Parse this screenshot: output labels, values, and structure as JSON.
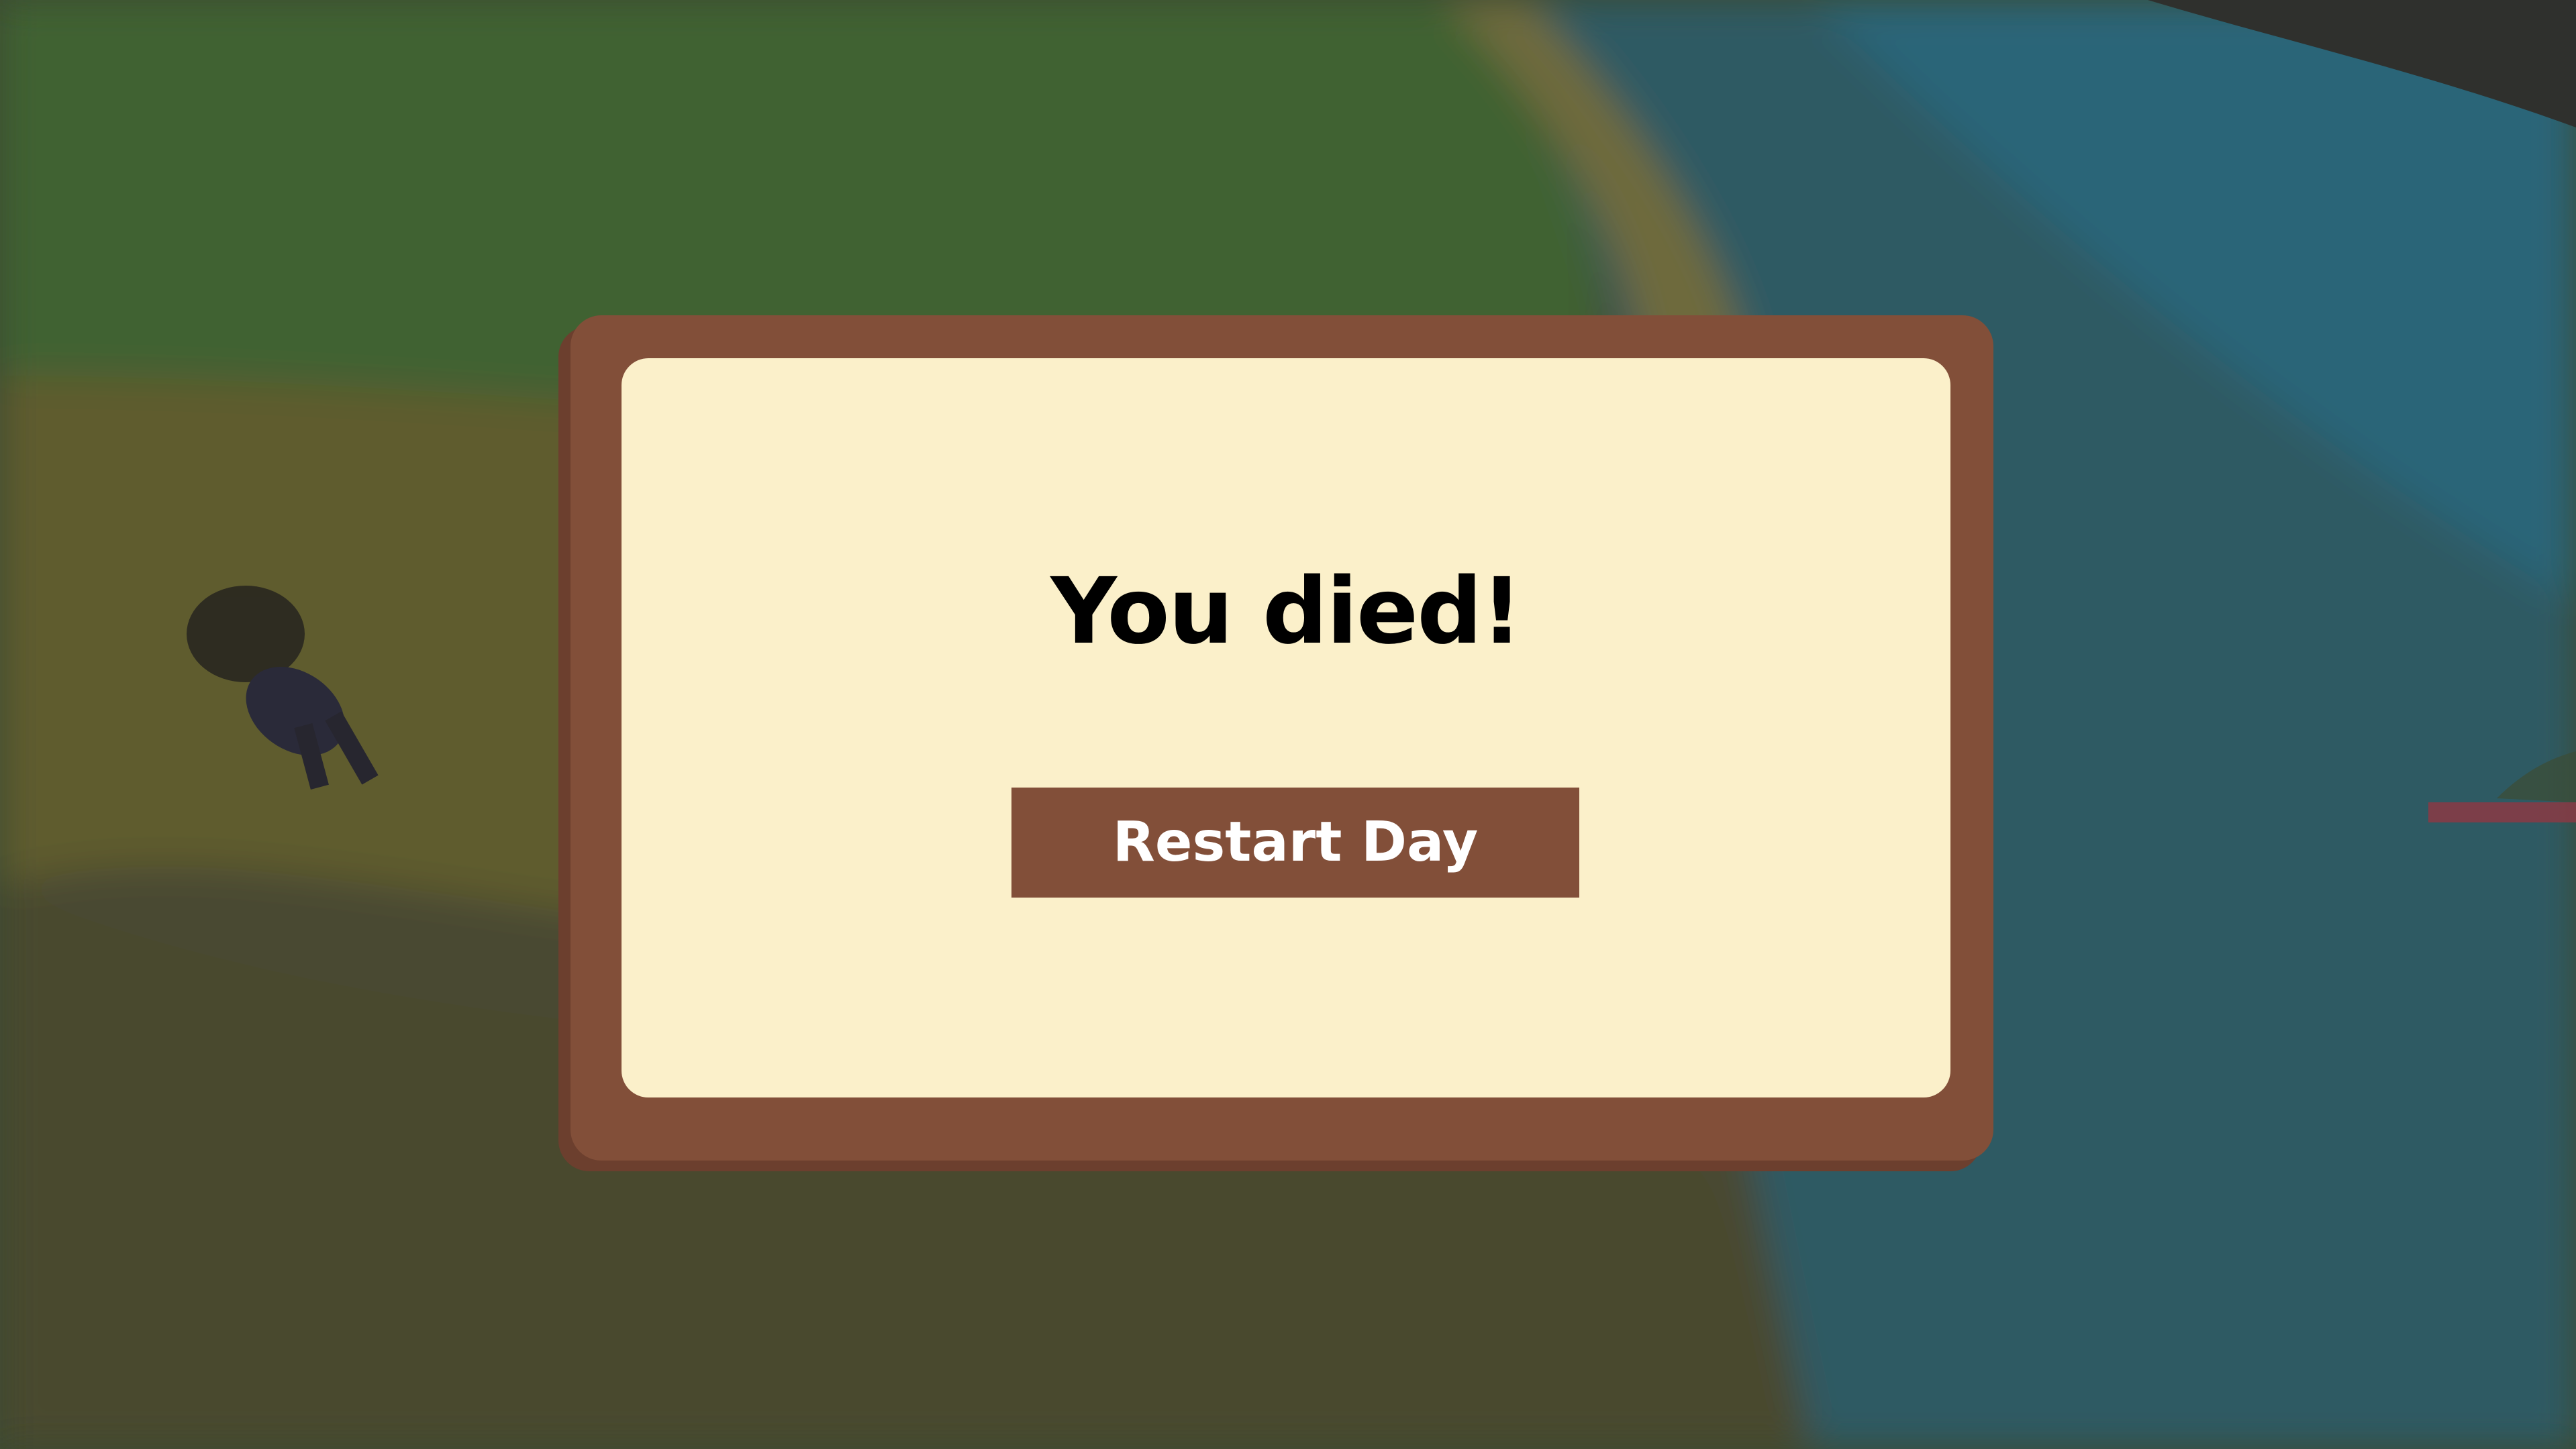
{
  "dialog": {
    "title": "You died!",
    "button_label": "Restart Day"
  },
  "colors": {
    "frame": "#824f39",
    "panel": "#fbf0ca",
    "button": "#824f39",
    "button_text": "#ffffff",
    "title_text": "#000000"
  }
}
